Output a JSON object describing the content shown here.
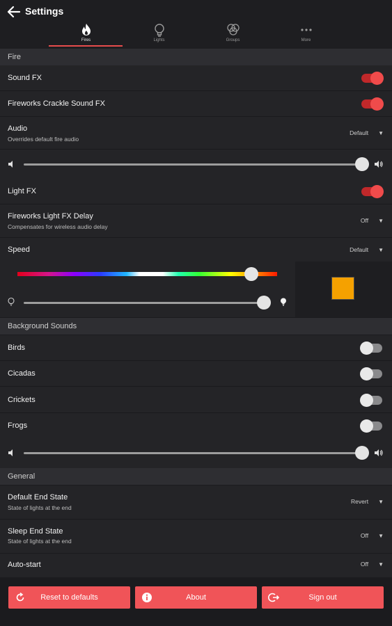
{
  "header": {
    "title": "Settings"
  },
  "tabs": [
    {
      "label": "Fires",
      "icon": "flame-icon",
      "active": true
    },
    {
      "label": "Lights",
      "icon": "bulb-icon"
    },
    {
      "label": "Groups",
      "icon": "groups-icon"
    },
    {
      "label": "More",
      "icon": "more-icon"
    }
  ],
  "fire": {
    "section_title": "Fire",
    "sound_fx": {
      "label": "Sound FX",
      "on": true
    },
    "fireworks_crackle": {
      "label": "Fireworks Crackle Sound FX",
      "on": true
    },
    "audio": {
      "label": "Audio",
      "sub": "Overrides default fire audio",
      "value": "Default"
    },
    "volume": {
      "level": 0.95
    },
    "light_fx": {
      "label": "Light FX",
      "on": true
    },
    "fireworks_delay": {
      "label": "Fireworks Light FX Delay",
      "sub": "Compensates for wireless audio delay",
      "value": "Off"
    },
    "speed": {
      "label": "Speed",
      "value": "Default"
    },
    "hue": {
      "level": 0.9
    },
    "brightness": {
      "level": 0.95
    },
    "swatch_color": "#f5a100"
  },
  "background_sounds": {
    "section_title": "Background Sounds",
    "items": [
      {
        "label": "Birds",
        "on": false
      },
      {
        "label": "Cicadas",
        "on": false
      },
      {
        "label": "Crickets",
        "on": false
      },
      {
        "label": "Frogs",
        "on": false
      }
    ],
    "volume": {
      "level": 0.95
    }
  },
  "general": {
    "section_title": "General",
    "default_end_state": {
      "label": "Default End State",
      "sub": "State of lights at the end",
      "value": "Revert"
    },
    "sleep_end_state": {
      "label": "Sleep End State",
      "sub": "State of lights at the end",
      "value": "Off"
    },
    "auto_start": {
      "label": "Auto-start",
      "value": "Off"
    }
  },
  "buttons": {
    "reset": "Reset to defaults",
    "about": "About",
    "sign_out": "Sign out"
  },
  "colors": {
    "accent": "#f05458",
    "toggle_on": "#f04b4b",
    "background": "#1b1b1e"
  }
}
